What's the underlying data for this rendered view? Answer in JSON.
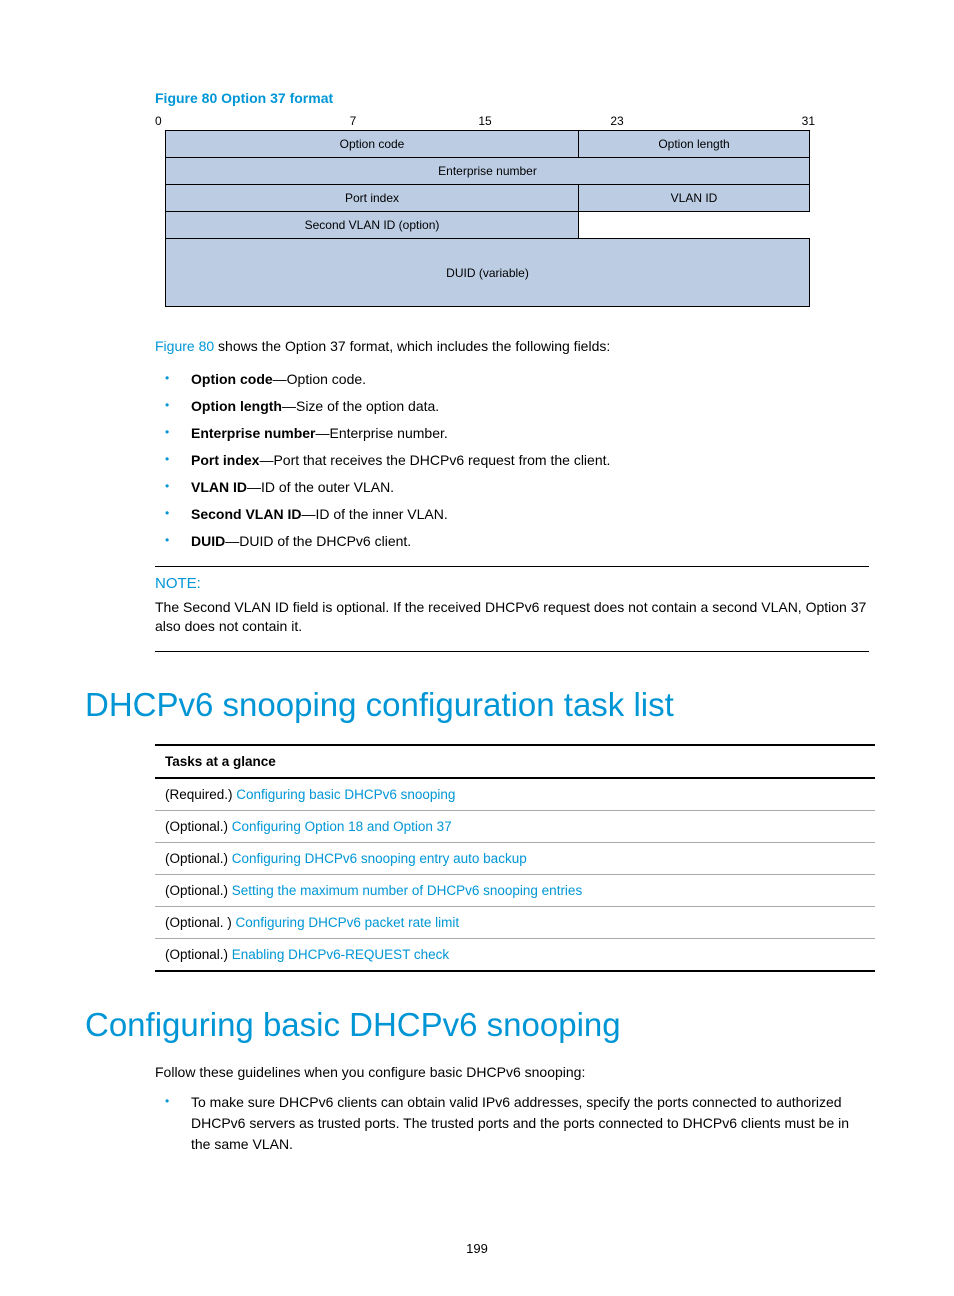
{
  "figure": {
    "title": "Figure 80 Option 37 format",
    "bits": [
      "0",
      "7",
      "15",
      "23",
      "31"
    ],
    "rows": {
      "r1a": "Option code",
      "r1b": "Option length",
      "r2": "Enterprise number",
      "r3a": "Port index",
      "r3b": "VLAN ID",
      "r4a": "Second VLAN ID (option)",
      "r5": "DUID (variable)"
    }
  },
  "intro": {
    "link": "Figure 80",
    "rest": " shows the Option 37 format, which includes the following fields:"
  },
  "fields": [
    {
      "term": "Option code",
      "desc": "—Option code."
    },
    {
      "term": "Option length",
      "desc": "—Size of the option data."
    },
    {
      "term": "Enterprise number",
      "desc": "—Enterprise number."
    },
    {
      "term": "Port index",
      "desc": "—Port that receives the DHCPv6 request from the client."
    },
    {
      "term": "VLAN ID",
      "desc": "—ID of the outer VLAN."
    },
    {
      "term": "Second VLAN ID",
      "desc": "—ID of the inner VLAN."
    },
    {
      "term": "DUID",
      "desc": "—DUID of the DHCPv6 client."
    }
  ],
  "note": {
    "label": "NOTE:",
    "text": "The Second VLAN ID field is optional. If the received DHCPv6 request does not contain a second VLAN, Option 37 also does not contain it."
  },
  "section1": {
    "heading": "DHCPv6 snooping configuration task list",
    "table_header": "Tasks at a glance",
    "rows": [
      {
        "prefix": "(Required.) ",
        "link": "Configuring basic DHCPv6 snooping"
      },
      {
        "prefix": "(Optional.) ",
        "link": "Configuring Option 18 and Option 37"
      },
      {
        "prefix": "(Optional.) ",
        "link": "Configuring DHCPv6 snooping entry auto backup"
      },
      {
        "prefix": "(Optional.) ",
        "link": "Setting the maximum number of DHCPv6 snooping entries"
      },
      {
        "prefix": "(Optional. ) ",
        "link": "Configuring DHCPv6 packet rate limit"
      },
      {
        "prefix": "(Optional.) ",
        "link": "Enabling DHCPv6-REQUEST check"
      }
    ]
  },
  "section2": {
    "heading": "Configuring basic DHCPv6 snooping",
    "intro": "Follow these guidelines when you configure basic DHCPv6 snooping:",
    "bullet": "To make sure DHCPv6 clients can obtain valid IPv6 addresses, specify the ports connected to authorized DHCPv6 servers as trusted ports. The trusted ports and the ports connected to DHCPv6 clients must be in the same VLAN."
  },
  "page_number": "199"
}
